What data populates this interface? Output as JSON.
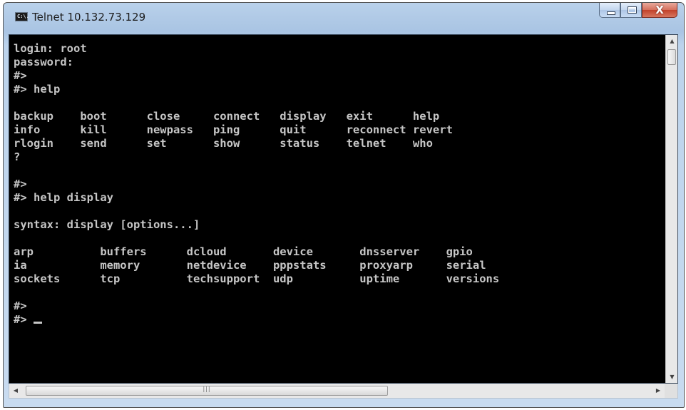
{
  "window": {
    "title": "Telnet 10.132.73.129",
    "icon": "console-icon",
    "icon_text": "C:\\.",
    "controls": {
      "minimize": "minimize-icon",
      "maximize": "maximize-icon",
      "close": "close-icon",
      "close_glyph": "X"
    }
  },
  "terminal": {
    "lines": [
      "login: root",
      "password:",
      "#>",
      "#> help",
      "",
      "backup    boot      close     connect   display   exit      help",
      "info      kill      newpass   ping      quit      reconnect revert",
      "rlogin    send      set       show      status    telnet    who",
      "?",
      "",
      "#>",
      "#> help display",
      "",
      "syntax: display [options...]",
      "",
      "arp          buffers      dcloud       device       dnsserver    gpio",
      "ia           memory       netdevice    pppstats     proxyarp     serial",
      "sockets      tcp          techsupport  udp          uptime       versions",
      "",
      "#>"
    ],
    "prompt": "#> "
  },
  "scrollbars": {
    "vertical": {
      "up": "scroll-up-arrow-icon",
      "down": "scroll-down-arrow-icon"
    },
    "horizontal": {
      "left": "scroll-left-arrow-icon",
      "right": "scroll-right-arrow-icon",
      "grip": "|||"
    }
  },
  "colors": {
    "terminal_bg": "#000000",
    "terminal_fg": "#c6c6c6",
    "titlebar": "#b9d1ea",
    "close_button": "#c2412a"
  }
}
